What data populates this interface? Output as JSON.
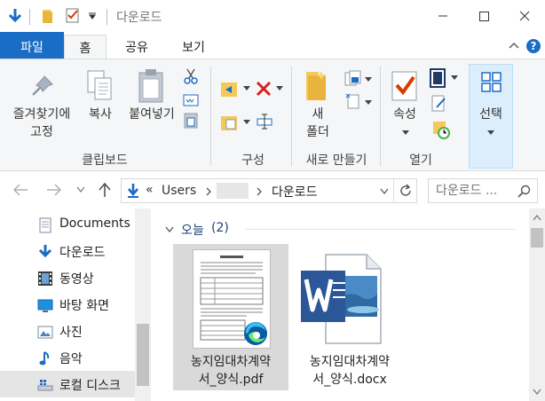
{
  "window": {
    "title": "다운로드"
  },
  "ribbon": {
    "tabs": [
      "파일",
      "홈",
      "공유",
      "보기"
    ],
    "clipboard": {
      "pin_label_1": "즐겨찾기에",
      "pin_label_2": "고정",
      "copy_label": "복사",
      "paste_label": "붙여넣기",
      "group_label": "클립보드"
    },
    "organize": {
      "group_label": "구성"
    },
    "new": {
      "new_folder_1": "새",
      "new_folder_2": "폴더",
      "group_label": "새로 만들기"
    },
    "open": {
      "properties_label": "속성",
      "group_label": "열기"
    },
    "select": {
      "select_label": "선택"
    }
  },
  "address": {
    "crumb_prefix": "«",
    "crumbs": [
      "Users",
      "",
      "다운로드"
    ],
    "search_placeholder": "다운로드 ..."
  },
  "nav": {
    "items": [
      {
        "label": "Documents",
        "icon": "documents-icon"
      },
      {
        "label": "다운로드",
        "icon": "download-arrow-icon"
      },
      {
        "label": "동영상",
        "icon": "video-icon"
      },
      {
        "label": "바탕 화면",
        "icon": "desktop-icon"
      },
      {
        "label": "사진",
        "icon": "pictures-icon"
      },
      {
        "label": "음악",
        "icon": "music-icon"
      },
      {
        "label": "로컬 디스크",
        "icon": "local-disk-icon"
      }
    ]
  },
  "content": {
    "group_header": "오늘",
    "group_count": "(2)",
    "files": [
      {
        "name_line1": "농지임대차계약",
        "name_line2": "서_양식.pdf",
        "icon": "pdf-edge-icon"
      },
      {
        "name_line1": "농지임대차계약",
        "name_line2": "서_양식.docx",
        "icon": "word-document-icon"
      }
    ]
  },
  "colors": {
    "file_tab": "#1a6cc4",
    "accent_blue": "#1a6cc4",
    "selection": "#cce8ff",
    "folder_yellow": "#f3c95b"
  }
}
